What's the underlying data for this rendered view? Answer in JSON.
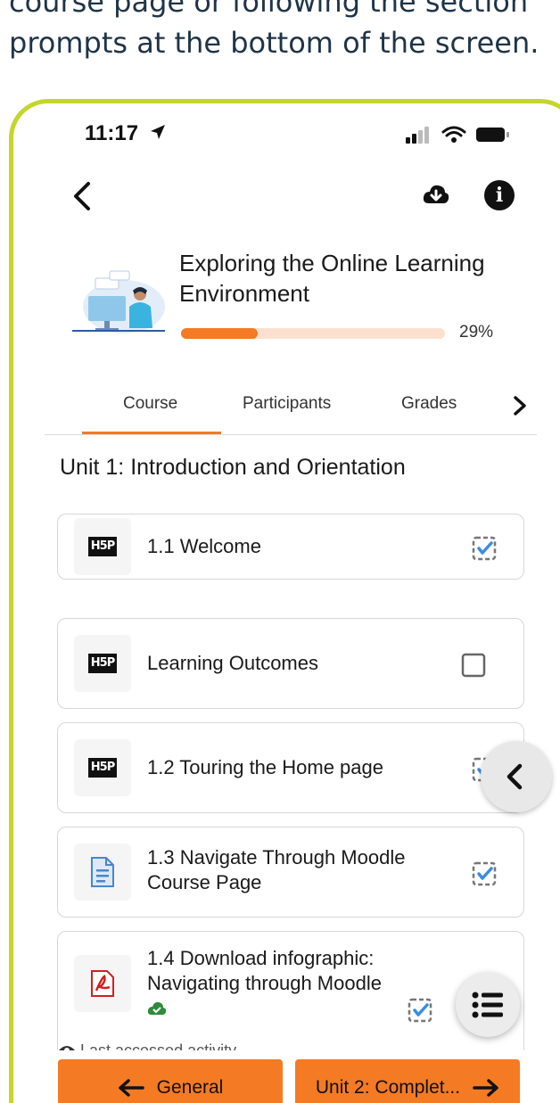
{
  "caption": {
    "line1": "course page or following the section",
    "line2": "prompts at the bottom of the screen."
  },
  "status_bar": {
    "time": "11:17"
  },
  "course": {
    "title": "Exploring the Online Learning Environment",
    "progress_fraction": 0.29,
    "progress_label": "29%"
  },
  "tabs": [
    {
      "label": "Course",
      "selected": true
    },
    {
      "label": "Participants",
      "selected": false
    },
    {
      "label": "Grades",
      "selected": false
    }
  ],
  "section": {
    "title": "Unit 1: Introduction and Orientation"
  },
  "activities": [
    {
      "label": "1.1 Welcome",
      "icon": "h5p-icon",
      "completed": true
    },
    {
      "label": "Learning Outcomes",
      "icon": "h5p-icon",
      "completed": false
    },
    {
      "label": "1.2 Touring the Home page",
      "icon": "h5p-icon",
      "completed": true
    },
    {
      "label": "1.3 Navigate Through Moodle Course Page",
      "icon": "page-document-icon",
      "completed": true
    },
    {
      "label": "1.4 Download infographic: Navigating through Moodle",
      "icon": "pdf-icon",
      "completed": true
    }
  ],
  "last_accessed": "Last accessed activity",
  "bottom_nav": {
    "prev_label": "General",
    "next_label": "Unit 2: Complet..."
  },
  "colors": {
    "accent": "#f47a24",
    "frame": "#c5d52c",
    "progress_track": "#fbe0d0",
    "check_blue": "#3b8de0"
  }
}
